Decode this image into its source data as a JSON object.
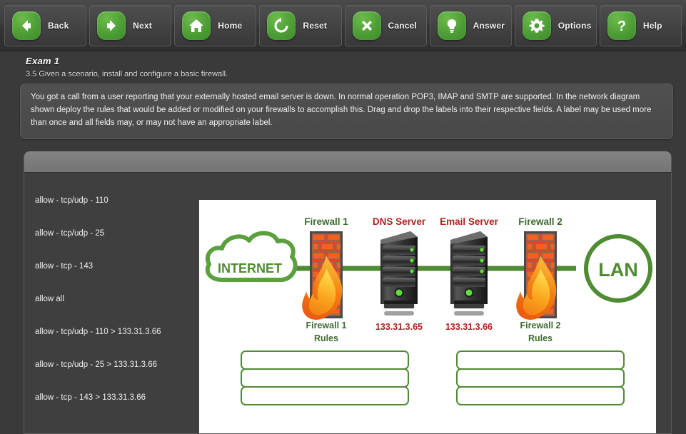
{
  "toolbar": {
    "buttons": [
      {
        "label": "Back",
        "icon": "arrow-left-icon"
      },
      {
        "label": "Next",
        "icon": "arrow-right-icon"
      },
      {
        "label": "Home",
        "icon": "home-icon"
      },
      {
        "label": "Reset",
        "icon": "refresh-icon"
      },
      {
        "label": "Cancel",
        "icon": "close-x-icon"
      },
      {
        "label": "Answer",
        "icon": "lightbulb-icon"
      },
      {
        "label": "Options",
        "icon": "gear-icon"
      },
      {
        "label": "Help",
        "icon": "question-mark-icon"
      }
    ],
    "accent_color": "#4e9e36"
  },
  "exam": {
    "title": "Exam 1",
    "objective": "3.5 Given a scenario, install and configure a basic firewall.",
    "scenario": "You got a call from a user reporting that your externally hosted email server is down. In normal operation POP3, IMAP and SMTP are supported. In the network diagram shown deploy the rules that would be added or modified on your firewalls to accomplish this. Drag and drop the labels into their respective fields. A label may be used more than once and all fields may, or may not have an appropriate label."
  },
  "labels": [
    "allow - tcp/udp - 110",
    "allow - tcp/udp - 25",
    "allow - tcp - 143",
    "allow all",
    "allow - tcp/udp - 110 > 133.31.3.66",
    "allow - tcp/udp - 25 > 133.31.3.66",
    "allow - tcp - 143 > 133.31.3.66"
  ],
  "diagram": {
    "internet_label": "INTERNET",
    "lan_label": "LAN",
    "nodes": [
      {
        "name": "Firewall 1",
        "type": "firewall",
        "caption": "Firewall 1 Rules",
        "caption_line1": "Firewall 1",
        "caption_line2": "Rules",
        "label_color": "#3d6b2e"
      },
      {
        "name": "DNS Server",
        "type": "server",
        "ip": "133.31.3.65",
        "label_color": "#b02020"
      },
      {
        "name": "Email Server",
        "type": "server",
        "ip": "133.31.3.66",
        "label_color": "#b02020"
      },
      {
        "name": "Firewall 2",
        "type": "firewall",
        "caption": "Firewall 2 Rules",
        "caption_line1": "Firewall 2",
        "caption_line2": "Rules",
        "label_color": "#3d6b2e"
      }
    ],
    "link_color": "#4f8b33",
    "drop_zones": {
      "firewall1": [
        "",
        "",
        ""
      ],
      "firewall2": [
        "",
        "",
        ""
      ]
    }
  }
}
